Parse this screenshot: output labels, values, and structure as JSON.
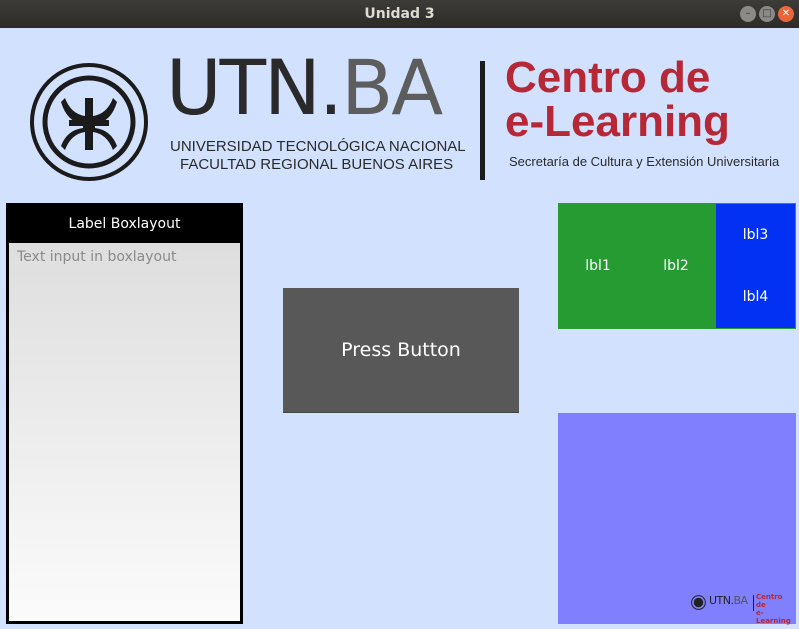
{
  "window": {
    "title": "Unidad 3",
    "minimize_glyph": "–",
    "maximize_glyph": "□",
    "close_glyph": "✕"
  },
  "banner": {
    "utn_dark": "UTN.",
    "utn_gray": "BA",
    "university_line1": "UNIVERSIDAD TECNOLÓGICA NACIONAL",
    "university_line2": "FACULTAD REGIONAL BUENOS AIRES",
    "centro_line1": "Centro de",
    "centro_line2": "e-Learning",
    "secretaria": "Secretaría de Cultura y Extensión Universitaria",
    "brand_red": "#b72837"
  },
  "left_panel": {
    "label": "Label Boxlayout",
    "text_input_placeholder": "Text input in boxlayout"
  },
  "press_button": {
    "label": "Press Button"
  },
  "grid_panel": {
    "labels": [
      "lbl1",
      "lbl2",
      "lbl3",
      "lbl4"
    ],
    "green": "#259b31",
    "blue": "#0331f4"
  },
  "image_panel": {
    "background": "#8080fe",
    "mini_logo": {
      "utn_dark": "UTN.",
      "utn_gray": "BA",
      "centro": "Centro de",
      "elearning": "e-Learning"
    }
  }
}
